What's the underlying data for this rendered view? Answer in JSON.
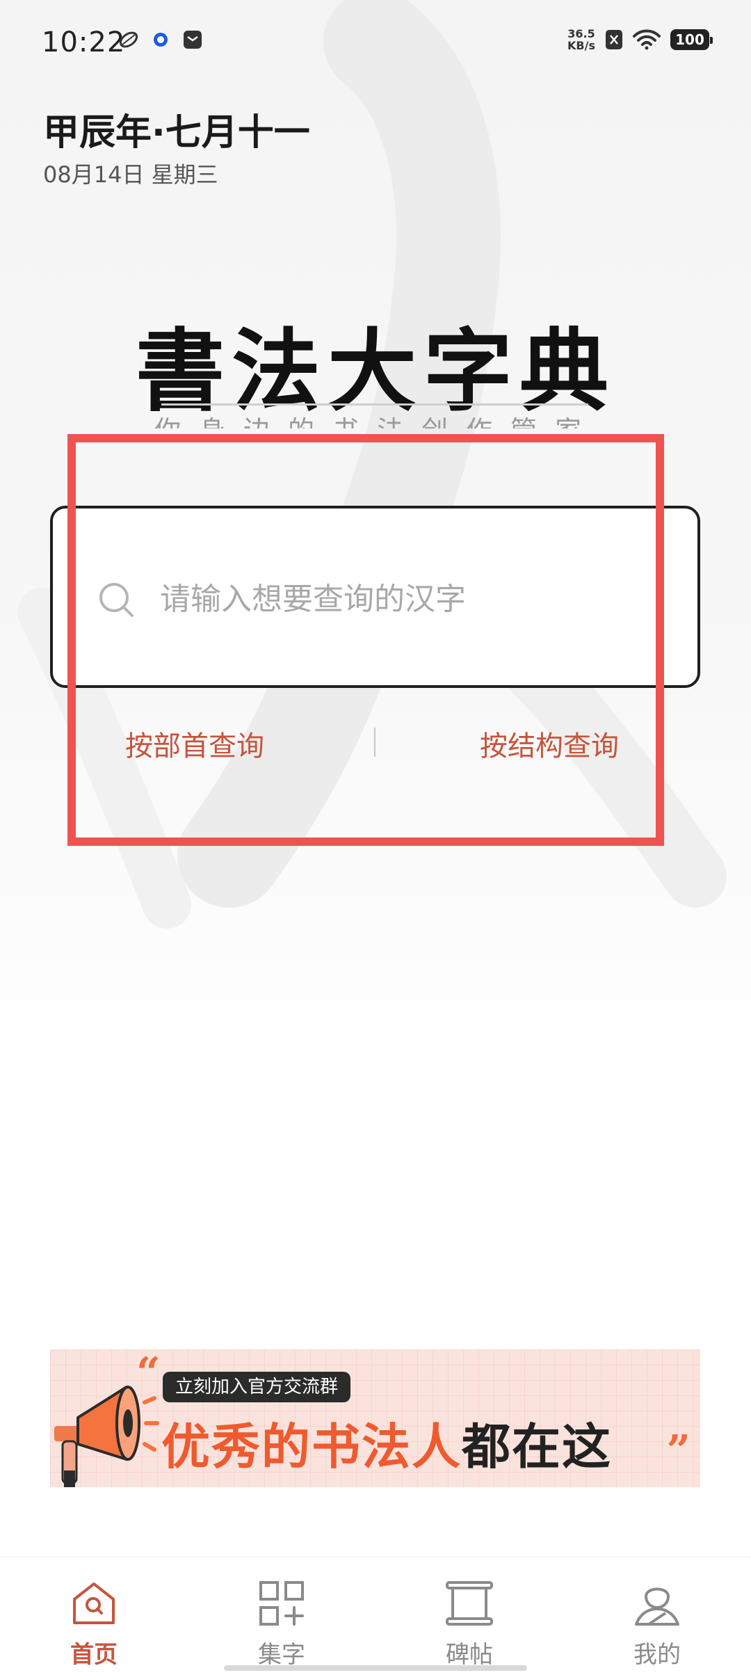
{
  "status_bar": {
    "time": "10:22",
    "net_speed_value": "36.5",
    "net_speed_unit": "KB/s",
    "battery": "100",
    "left_icons": [
      "leaf-app-icon",
      "blue-ring-icon",
      "message-icon"
    ],
    "right_icons": [
      "no-sim-icon",
      "wifi-icon",
      "battery-icon"
    ]
  },
  "date": {
    "lunar": "甲辰年·七月十一",
    "solar": "08月14日 星期三"
  },
  "logo": {
    "title": "書法大字典",
    "subtitle": "你身边的书法创作管家"
  },
  "search": {
    "placeholder": "请输入想要查询的汉字",
    "value": ""
  },
  "query_links": {
    "radical": "按部首查询",
    "structure": "按结构查询"
  },
  "banner": {
    "tag": "立刻加入官方交流群",
    "headline_a": "优秀的书法人",
    "headline_b": "都在这里！",
    "quote_open": "“",
    "quote_close": "”"
  },
  "bottom_nav": {
    "items": [
      {
        "label": "首页",
        "icon": "home-icon",
        "active": true
      },
      {
        "label": "集字",
        "icon": "grid-plus-icon",
        "active": false
      },
      {
        "label": "碑帖",
        "icon": "scroll-icon",
        "active": false
      },
      {
        "label": "我的",
        "icon": "profile-icon",
        "active": false
      }
    ]
  },
  "colors": {
    "accent": "#c5553d",
    "highlight": "#ef5350",
    "banner_orange": "#ef5a2f",
    "banner_bg": "#fbe3dd"
  }
}
